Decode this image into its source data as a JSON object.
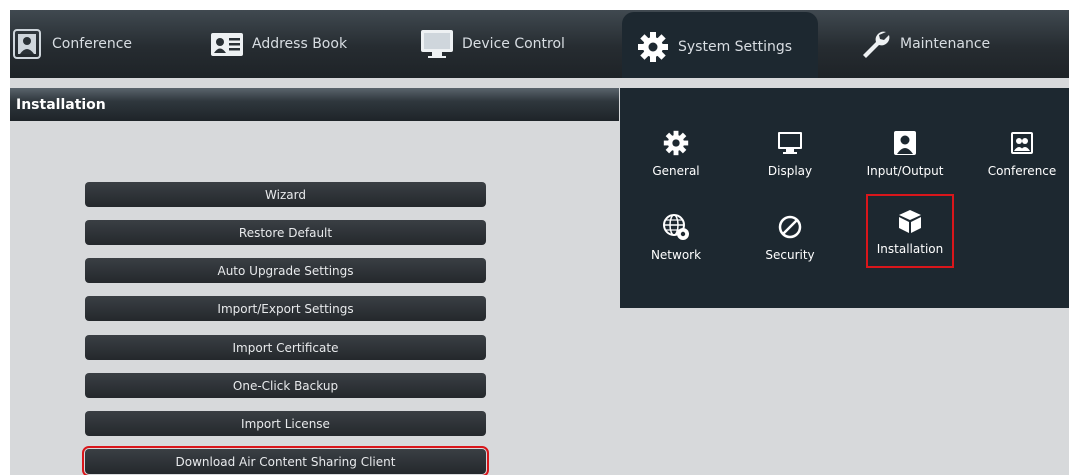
{
  "nav": {
    "tabs": [
      {
        "label": "Conference",
        "icon": "conference-icon"
      },
      {
        "label": "Address Book",
        "icon": "address-book-icon"
      },
      {
        "label": "Device Control",
        "icon": "monitor-icon"
      },
      {
        "label": "System Settings",
        "icon": "gear-icon",
        "active": true
      },
      {
        "label": "Maintenance",
        "icon": "wrench-icon"
      }
    ]
  },
  "section": {
    "title": "Installation"
  },
  "buttons": [
    "Wizard",
    "Restore Default",
    "Auto Upgrade Settings",
    "Import/Export Settings",
    "Import Certificate",
    "One-Click Backup",
    "Import License",
    "Download Air Content Sharing Client"
  ],
  "dropdown": {
    "items": [
      {
        "label": "General",
        "icon": "gear-icon"
      },
      {
        "label": "Display",
        "icon": "monitor-icon"
      },
      {
        "label": "Input/Output",
        "icon": "person-icon"
      },
      {
        "label": "Conference",
        "icon": "conference-icon"
      },
      {
        "label": "Network",
        "icon": "network-icon"
      },
      {
        "label": "Security",
        "icon": "no-entry-icon"
      },
      {
        "label": "Installation",
        "icon": "box-icon",
        "selected": true
      }
    ]
  },
  "colors": {
    "highlight": "#d9161b",
    "panel": "#1d2830",
    "background": "#d7d9db"
  }
}
